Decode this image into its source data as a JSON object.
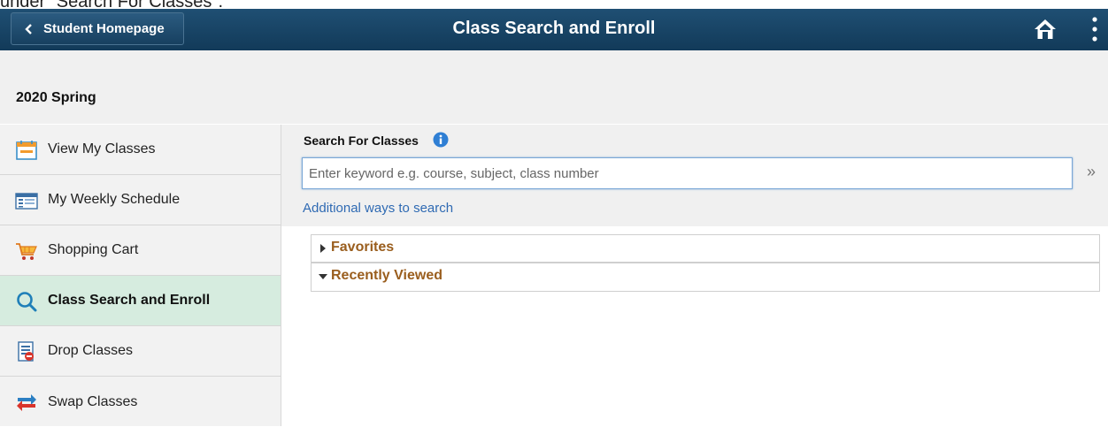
{
  "caption": "under \"Search For Classes\".",
  "header": {
    "back_label": "Student Homepage",
    "title": "Class Search and Enroll"
  },
  "term": "2020 Spring",
  "sidebar": {
    "items": [
      {
        "label": "View My Classes",
        "icon": "calendar-icon"
      },
      {
        "label": "My Weekly Schedule",
        "icon": "schedule-icon"
      },
      {
        "label": "Shopping Cart",
        "icon": "cart-icon"
      },
      {
        "label": "Class Search and Enroll",
        "icon": "search-icon",
        "active": true
      },
      {
        "label": "Drop Classes",
        "icon": "drop-icon"
      },
      {
        "label": "Swap Classes",
        "icon": "swap-icon"
      }
    ]
  },
  "search": {
    "label": "Search For Classes",
    "placeholder": "Enter keyword e.g. course, subject, class number",
    "value": "",
    "go_label": "»",
    "additional_link": "Additional ways to search"
  },
  "sections": {
    "favorites": "Favorites",
    "recently_viewed": "Recently Viewed"
  },
  "colors": {
    "header": "#1a4566",
    "active_nav": "#d6ecdf",
    "link": "#2f6ab3",
    "section_label": "#9a5e1e"
  }
}
